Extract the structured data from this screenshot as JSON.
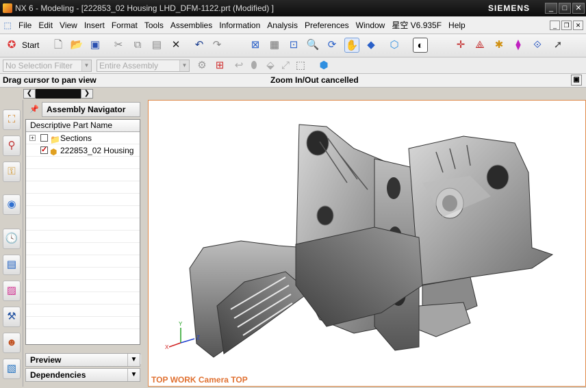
{
  "window": {
    "title": "NX 6 - Modeling - [222853_02 Housing LHD_DFM-1122.prt (Modified) ]",
    "brand": "SIEMENS"
  },
  "menu": [
    "File",
    "Edit",
    "View",
    "Insert",
    "Format",
    "Tools",
    "Assemblies",
    "Information",
    "Analysis",
    "Preferences",
    "Window",
    "星空 V6.935F",
    "Help"
  ],
  "toolbar": {
    "start_label": "Start"
  },
  "selection": {
    "filter": "No Selection Filter",
    "scope": "Entire Assembly"
  },
  "status": {
    "left": "Drag cursor to pan view",
    "right": "Zoom In/Out cancelled"
  },
  "navigator": {
    "title": "Assembly Navigator",
    "column": "Descriptive Part Name",
    "items": [
      {
        "label": "Sections",
        "checked": false
      },
      {
        "label": "222853_02 Housing",
        "checked": true
      }
    ],
    "preview_label": "Preview",
    "dependencies_label": "Dependencies"
  },
  "viewport": {
    "label": "TOP WORK Camera TOP",
    "triad": {
      "x": "X",
      "y": "Y",
      "z": "Z"
    }
  },
  "colors": {
    "accent": "#e07030",
    "brand_bar": "#111111"
  }
}
